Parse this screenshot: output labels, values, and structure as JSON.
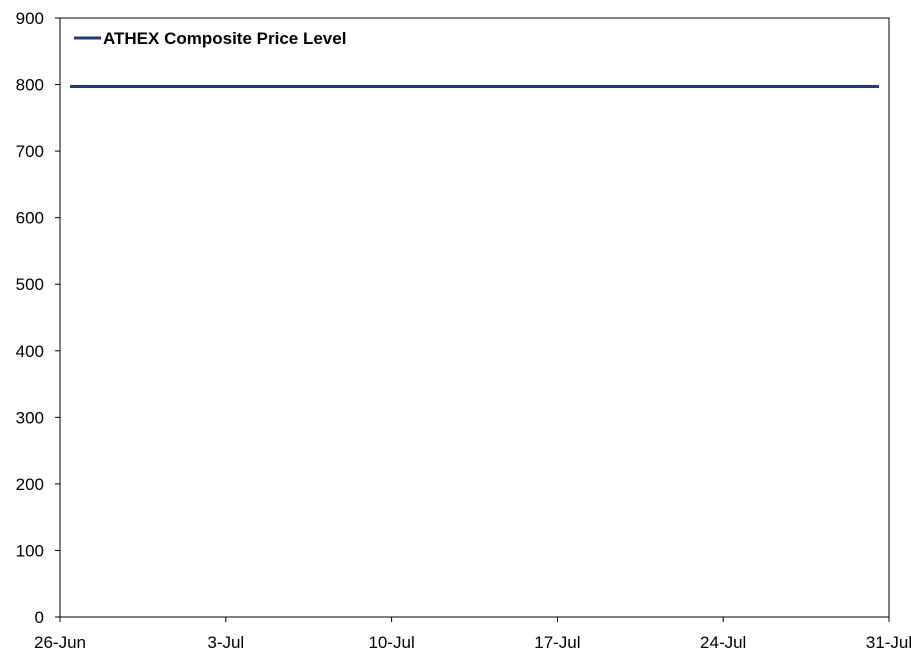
{
  "chart_data": {
    "type": "line",
    "title": "",
    "xlabel": "",
    "ylabel": "",
    "ylim": [
      0,
      900
    ],
    "yticks": [
      0,
      100,
      200,
      300,
      400,
      500,
      600,
      700,
      800,
      900
    ],
    "xlim": [
      "2024-06-26",
      "2024-07-31"
    ],
    "xticks": [
      {
        "date": "2024-06-26",
        "label": "26-Jun"
      },
      {
        "date": "2024-07-03",
        "label": "3-Jul"
      },
      {
        "date": "2024-07-10",
        "label": "10-Jul"
      },
      {
        "date": "2024-07-17",
        "label": "17-Jul"
      },
      {
        "date": "2024-07-24",
        "label": "24-Jul"
      },
      {
        "date": "2024-07-31",
        "label": "31-Jul"
      }
    ],
    "grid": false,
    "legend": {
      "position": "top-left"
    },
    "series": [
      {
        "name": "ATHEX Composite Price Level",
        "color": "#1f3a7a",
        "x": [
          "2024-06-26",
          "2024-07-31"
        ],
        "values": [
          797,
          797
        ]
      }
    ]
  }
}
